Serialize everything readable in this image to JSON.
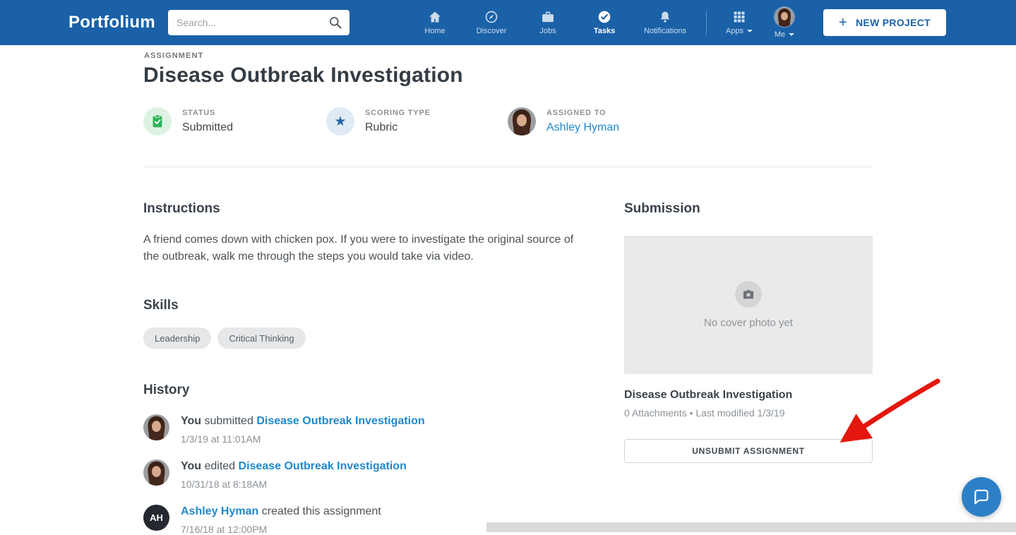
{
  "navbar": {
    "brand": "Portfolium",
    "search_placeholder": "Search...",
    "items": [
      {
        "label": "Home"
      },
      {
        "label": "Discover"
      },
      {
        "label": "Jobs"
      },
      {
        "label": "Tasks"
      },
      {
        "label": "Notifications"
      }
    ],
    "apps_label": "Apps",
    "me_label": "Me",
    "new_project_label": "NEW PROJECT",
    "plus_glyph": "+"
  },
  "assignment": {
    "eyebrow": "ASSIGNMENT",
    "title": "Disease Outbreak Investigation",
    "meta": {
      "status_label": "STATUS",
      "status_value": "Submitted",
      "scoring_label": "SCORING TYPE",
      "scoring_value": "Rubric",
      "assigned_label": "ASSIGNED TO",
      "assigned_value": "Ashley Hyman"
    }
  },
  "instructions": {
    "heading": "Instructions",
    "body": "A friend comes down with chicken pox. If you were to investigate the original source of the outbreak, walk me through the steps you would take via video."
  },
  "skills": {
    "heading": "Skills",
    "chips": [
      "Leadership",
      "Critical Thinking"
    ]
  },
  "history": {
    "heading": "History",
    "items": [
      {
        "actor": "You",
        "action": "submitted",
        "object": "Disease Outbreak Investigation",
        "timestamp": "1/3/19 at 11:01AM"
      },
      {
        "actor": "You",
        "action": "edited",
        "object": "Disease Outbreak Investigation",
        "timestamp": "10/31/18 at 8:18AM"
      },
      {
        "actor": "Ashley Hyman",
        "action": "created this assignment",
        "object": "",
        "timestamp": "7/16/18 at 12:00PM",
        "initials": "AH"
      }
    ]
  },
  "submission": {
    "heading": "Submission",
    "cover_placeholder": "No cover photo yet",
    "title": "Disease Outbreak Investigation",
    "meta": "0 Attachments • Last modified 1/3/19",
    "unsubmit_label": "UNSUBMIT ASSIGNMENT"
  },
  "icons": {
    "star_glyph": "★"
  },
  "colors": {
    "navbar_blue": "#1a61a8",
    "link_blue": "#2089cc",
    "status_green": "#2eb35a",
    "arrow_red": "#e3170d",
    "intercom_blue": "#2e80c6"
  }
}
